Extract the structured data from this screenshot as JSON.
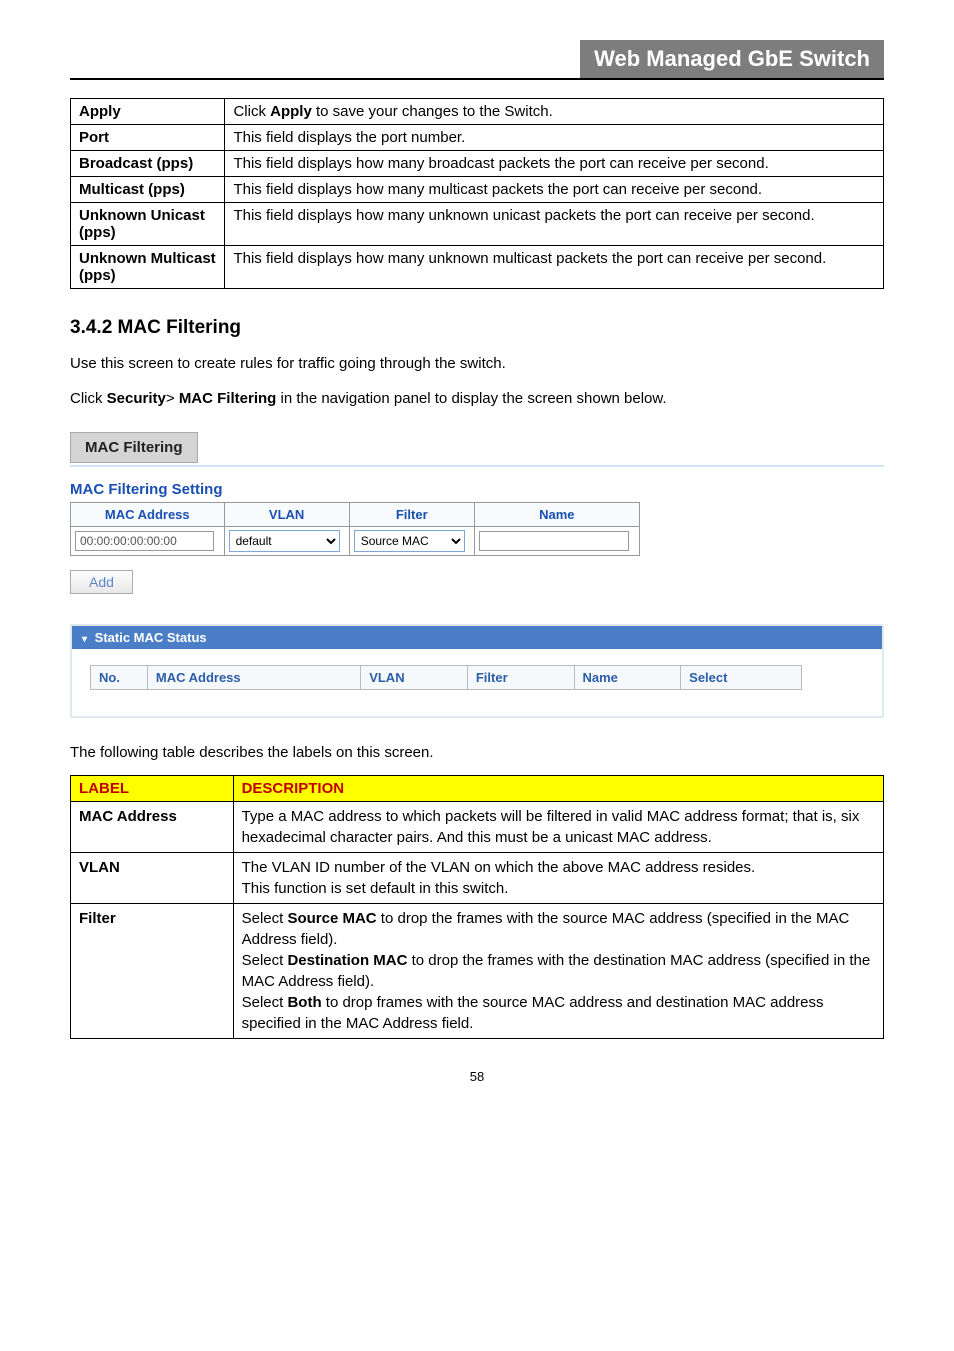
{
  "header": {
    "title": "Web Managed GbE Switch"
  },
  "upper_table": {
    "rows": [
      {
        "label": "Apply",
        "desc_pre": "Click ",
        "desc_bold": "Apply",
        "desc_post": " to save your changes to the Switch."
      },
      {
        "label": "Port",
        "desc": "This field displays the port number."
      },
      {
        "label": "Broadcast (pps)",
        "desc": "This field displays how many broadcast packets the port can receive per second."
      },
      {
        "label": "Multicast (pps)",
        "desc": "This field displays how many multicast packets the port can receive per second."
      },
      {
        "label": "Unknown Unicast (pps)",
        "desc": "This field displays how many unknown unicast packets the port can receive per second."
      },
      {
        "label": "Unknown Multicast (pps)",
        "desc": "This field displays how many unknown multicast packets the port can receive per second."
      }
    ]
  },
  "section": {
    "number": "3.4.2",
    "title": "MAC Filtering",
    "intro_line": "Use this screen to create rules for traffic going through the switch.",
    "nav_line_pre": "Click ",
    "nav_bold1": "Security",
    "nav_mid": "> ",
    "nav_bold2": "MAC Filtering",
    "nav_post": " in the navigation panel to display the screen shown below."
  },
  "tab": {
    "label": "MAC Filtering"
  },
  "setting": {
    "heading": "MAC Filtering Setting",
    "headers": {
      "mac": "MAC Address",
      "vlan": "VLAN",
      "filter": "Filter",
      "name": "Name"
    },
    "row": {
      "mac_value": "00:00:00:00:00:00",
      "vlan_value": "default",
      "filter_value": "Source MAC",
      "name_value": ""
    },
    "add_button": "Add"
  },
  "status_panel": {
    "title": "Static MAC Status",
    "headers": {
      "no": "No.",
      "mac": "MAC Address",
      "vlan": "VLAN",
      "filter": "Filter",
      "name": "Name",
      "select": "Select"
    }
  },
  "desc_intro": "The following table describes the labels on this screen.",
  "desc_table": {
    "headers": {
      "label": "LABEL",
      "desc": "DESCRIPTION"
    },
    "rows": {
      "mac_address": {
        "label": "MAC Address",
        "desc": "Type a MAC address to which packets will be filtered in valid MAC address format; that is, six hexadecimal character pairs. And this must be a unicast MAC address."
      },
      "vlan": {
        "label": "VLAN",
        "line1": "The VLAN ID number of the VLAN on which the above MAC address resides.",
        "line2": "This function is set default in this switch."
      },
      "filter": {
        "label": "Filter",
        "p1_pre": "Select ",
        "p1_bold": "Source MAC",
        "p1_post": " to drop the frames with the source MAC address (specified in the MAC Address field).",
        "p2_pre": "Select ",
        "p2_bold": "Destination MAC",
        "p2_post": " to drop the frames with the destination MAC address (specified in the MAC Address field).",
        "p3_pre": "Select ",
        "p3_bold": "Both",
        "p3_post": " to drop frames with the source MAC address and destination MAC address specified in the MAC Address field."
      }
    }
  },
  "page_number": "58"
}
